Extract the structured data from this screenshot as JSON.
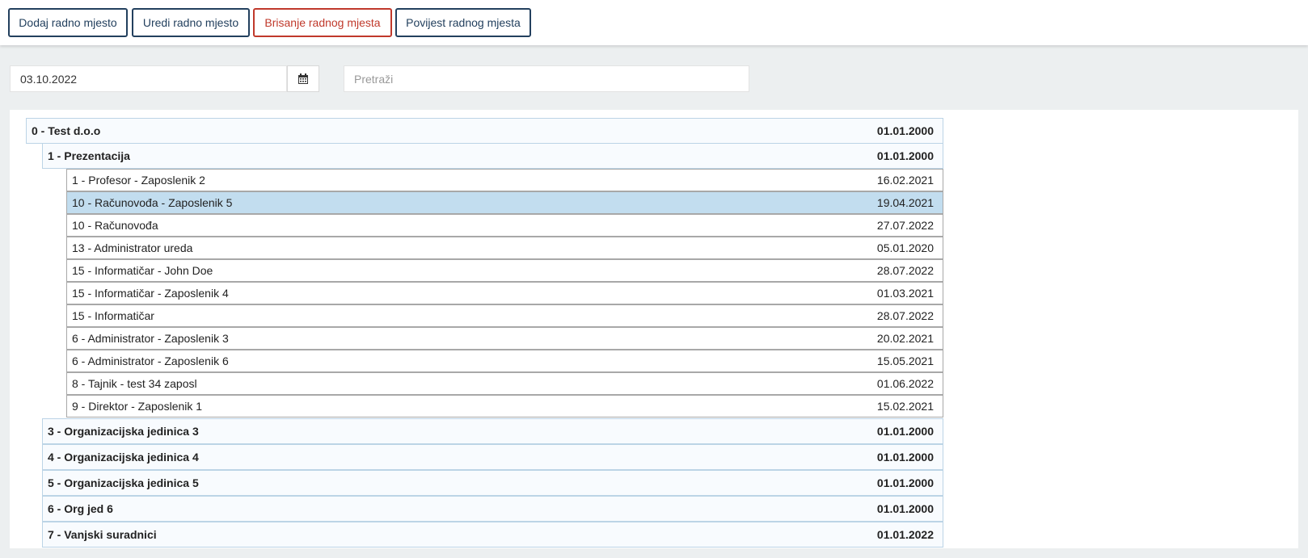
{
  "toolbar": {
    "add_label": "Dodaj radno mjesto",
    "edit_label": "Uredi radno mjesto",
    "delete_label": "Brisanje radnog mjesta",
    "history_label": "Povijest radnog mjesta"
  },
  "filters": {
    "date_value": "03.10.2022",
    "calendar_icon": "calendar-icon",
    "search_placeholder": "Pretraži"
  },
  "tree": {
    "root": {
      "label": "0 - Test d.o.o",
      "date": "01.01.2000"
    },
    "units": [
      {
        "label": "1 - Prezentacija",
        "date": "01.01.2000"
      },
      {
        "label": "3 - Organizacijska jedinica 3",
        "date": "01.01.2000"
      },
      {
        "label": "4 - Organizacijska jedinica 4",
        "date": "01.01.2000"
      },
      {
        "label": "5 - Organizacijska jedinica 5",
        "date": "01.01.2000"
      },
      {
        "label": "6 - Org jed 6",
        "date": "01.01.2000"
      },
      {
        "label": "7 - Vanjski suradnici",
        "date": "01.01.2022"
      }
    ],
    "positions": [
      {
        "label": "1 - Profesor - Zaposlenik 2",
        "date": "16.02.2021",
        "selected": false
      },
      {
        "label": "10 - Računovođa - Zaposlenik 5",
        "date": "19.04.2021",
        "selected": true
      },
      {
        "label": "10 - Računovođa",
        "date": "27.07.2022",
        "selected": false
      },
      {
        "label": "13 - Administrator ureda",
        "date": "05.01.2020",
        "selected": false
      },
      {
        "label": "15 - Informatičar - John Doe",
        "date": "28.07.2022",
        "selected": false
      },
      {
        "label": "15 - Informatičar - Zaposlenik 4",
        "date": "01.03.2021",
        "selected": false
      },
      {
        "label": "15 - Informatičar",
        "date": "28.07.2022",
        "selected": false
      },
      {
        "label": "6 - Administrator - Zaposlenik 3",
        "date": "20.02.2021",
        "selected": false
      },
      {
        "label": "6 - Administrator - Zaposlenik 6",
        "date": "15.05.2021",
        "selected": false
      },
      {
        "label": "8 - Tajnik - test 34 zaposl",
        "date": "01.06.2022",
        "selected": false
      },
      {
        "label": "9 - Direktor - Zaposlenik 1",
        "date": "15.02.2021",
        "selected": false
      }
    ]
  },
  "colors": {
    "primary_border": "#23405e",
    "danger": "#c0392b",
    "selected_row": "#c2ddef",
    "unit_row_border": "#bcd4e6"
  }
}
